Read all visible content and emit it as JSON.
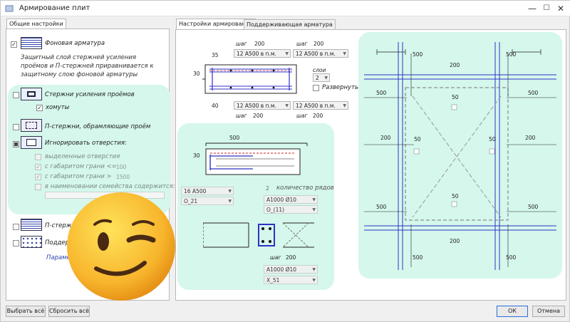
{
  "window": {
    "title": "Армирование плит"
  },
  "left_tab": {
    "label": "Общие настройки"
  },
  "background_reinforcement": {
    "label": "Фоновая арматура",
    "checked": true,
    "note": "Защитный слой стержней усиления проёмов и П-стержней приравнивается к защитному слою фоновой арматуры"
  },
  "opening_rods": {
    "label": "Стержни усиления проёмов",
    "checked": false
  },
  "clamps": {
    "label": "хомуты",
    "checked": true
  },
  "p_rods_frame": {
    "label": "П-стержни, обрамляющие проём",
    "checked": false
  },
  "ignore_openings": {
    "label": "Игнорировать отверстия:",
    "state": "partial"
  },
  "ignore_options": [
    {
      "label": "выделенные отверстия",
      "checked": false,
      "value": ""
    },
    {
      "label": "с габаритом грани <=",
      "checked": true,
      "value": "100"
    },
    {
      "label": "с габаритом грани >",
      "checked": true,
      "value": "1500"
    },
    {
      "label": "в наименовании семейства содержится:",
      "checked": false,
      "value": ""
    }
  ],
  "p_rods_short": {
    "label": "П-стержни"
  },
  "support_short": {
    "label": "Поддер"
  },
  "params_link": {
    "label": "Параме"
  },
  "right_tabs": [
    "Настройки армирования",
    "Поддерживающая арматура"
  ],
  "section": {
    "step_label": "шаг",
    "top_step_left": "200",
    "top_step_right": "200",
    "top_left_select": "12 A500 в п.м.",
    "top_right_select": "12 A500 в п.м.",
    "bottom_left_select": "12 A500 в п.м.",
    "bottom_right_select": "12 A500 в п.м.",
    "bottom_step_left": "200",
    "bottom_step_right": "200",
    "dim_35": "35",
    "dim_30": "30",
    "dim_40": "40",
    "layers_label": "слои",
    "layers_value": "2",
    "unfold_label": "Развернуть",
    "unfold_checked": false
  },
  "edge": {
    "dim_500": "500",
    "dim_30": "30",
    "rod_select": "16 A500",
    "shape_select": "О_21",
    "rows_value": "2",
    "rows_label": "количество рядов",
    "rebar_select_1": "A1000 Ø10",
    "shape_select_1": "О_(11)",
    "step_label": "шаг",
    "step_value": "200",
    "rebar_select_2": "A1000 Ø10",
    "shape_select_2": "Х_51"
  },
  "plan": {
    "dims": {
      "d500": "500",
      "d200": "200",
      "d50": "50"
    }
  },
  "footer": {
    "select_all": "Выбрать всё",
    "reset_all": "Сбросить всё",
    "ok": "ОК",
    "cancel": "Отмена"
  },
  "colors": {
    "mint": "#d5f7ec",
    "accent": "#2b6fd6",
    "rebar_blue": "#3030c8",
    "rebar_red": "#d02020"
  }
}
